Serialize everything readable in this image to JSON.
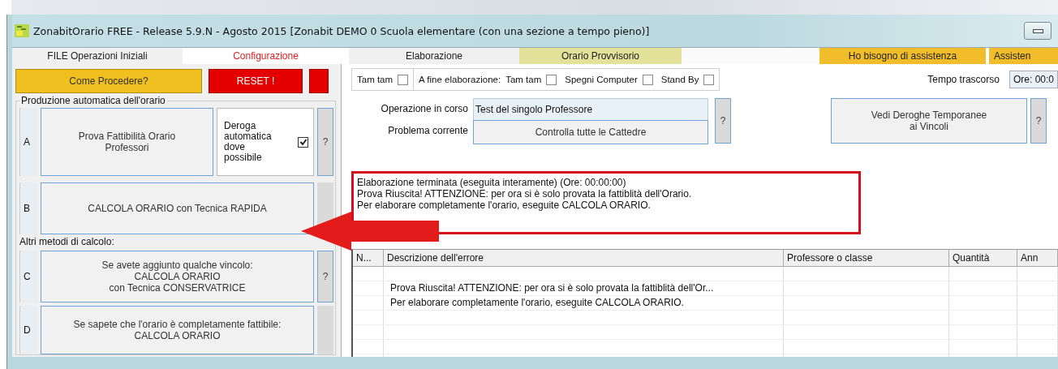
{
  "window": {
    "title": "ZonabitOrario FREE - Release 5.9.N - Agosto 2015 [Zonabit DEMO 0 Scuola elementare (con una sezione a tempo pieno)]"
  },
  "tabs": [
    {
      "label": "FILE Operazioni Iniziali",
      "selected": false,
      "color": "#f0f0f0"
    },
    {
      "label": "Configurazione",
      "selected": true,
      "color": "#ffffff"
    },
    {
      "label": "Elaborazione",
      "selected": false,
      "color": "#f0f0f0"
    },
    {
      "label": "Orario Provvisorio",
      "selected": false,
      "color": "#e3e19a"
    },
    {
      "label": "Ho bisogno di assistenza",
      "selected": false,
      "color": "#f2bd2a"
    },
    {
      "label": "Assisten",
      "selected": false,
      "color": "#f2bd2a"
    }
  ],
  "top_buttons": [
    {
      "label": "Come  Procedere?",
      "kind": "warning"
    },
    {
      "label": "RESET !",
      "kind": "danger"
    },
    {
      "kind": "danger"
    }
  ],
  "production": {
    "legend": "Produzione automatica dell'orario",
    "rows": [
      {
        "letter": "A",
        "label": "Prova Fattibilità Orario\nProfessori",
        "help": "?",
        "option": {
          "label": "Deroga\nautomatica\ndove\npossibile",
          "checked": true
        }
      },
      {
        "letter": "B",
        "label": "CALCOLA ORARIO con Tecnica RAPIDA",
        "help": ""
      }
    ],
    "other_heading": "Altri metodi di calcolo:",
    "other_rows": [
      {
        "letter": "C",
        "label": "Se avete aggiunto qualche vincolo:\nCALCOLA ORARIO\ncon Tecnica CONSERVATRICE",
        "help": "?"
      },
      {
        "letter": "D",
        "label": "Se sapete che l'orario è completamente fattibile:\nCALCOLA ORARIO",
        "help": ""
      }
    ]
  },
  "options": {
    "tamtam": {
      "label": "Tam tam",
      "checked": false
    },
    "end_label": "A fine elaborazione:",
    "end_options": [
      {
        "label": "Tam tam",
        "checked": false
      },
      {
        "label": "Spegni Computer",
        "checked": false
      },
      {
        "label": "Stand By",
        "checked": false
      }
    ]
  },
  "elapsed": {
    "label": "Tempo trascorso",
    "value": "Ore: 00:0"
  },
  "status": {
    "operation_label": "Operazione in corso",
    "operation_value": "Test del singolo Professore",
    "problem_label": "Problema corrente",
    "problem_button": "Controlla tutte le Cattedre",
    "help": "?"
  },
  "deroghe": {
    "label": "Vedi Deroghe Temporanee\nai Vincoli",
    "help": "?"
  },
  "message": [
    "Elaborazione terminata (eseguita interamente) (Ore: 00:00:00)",
    "Prova Riuscita! ATTENZIONE: per ora si è solo provata la fattiblità dell'Orario.",
    "Per elaborare completamente l'orario, eseguite CALCOLA ORARIO."
  ],
  "table": {
    "columns": [
      "N...",
      "Descrizione dell'errore",
      "Professore o classe",
      "Quantità",
      "Ann"
    ],
    "rows": [
      [
        "",
        "",
        "",
        "",
        ""
      ],
      [
        "",
        "Prova Riuscita! ATTENZIONE: per ora si è solo provata la fattiblità dell'Or...",
        "",
        "",
        ""
      ],
      [
        "",
        "Per elaborare completamente l'orario, eseguite CALCOLA ORARIO.",
        "",
        "",
        ""
      ],
      [
        "",
        "",
        "",
        "",
        ""
      ],
      [
        "",
        "",
        "",
        "",
        ""
      ],
      [
        "",
        "",
        "",
        "",
        ""
      ],
      [
        "",
        "",
        "",
        "",
        ""
      ]
    ]
  }
}
